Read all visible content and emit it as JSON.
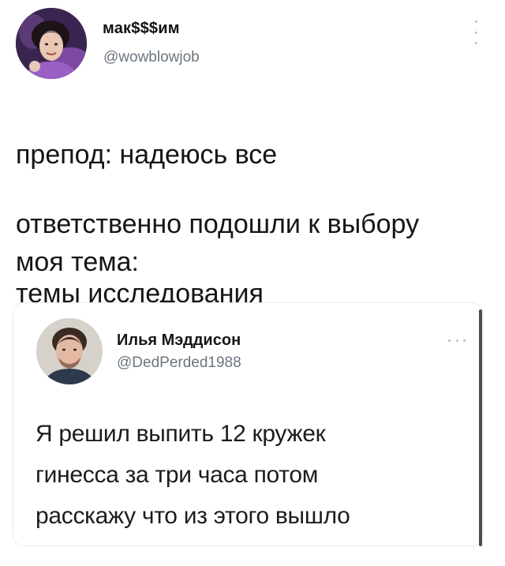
{
  "author": {
    "name": "мак$$$им",
    "handle": "@wowblowjob",
    "avatar_icon": "profile-photo-icon"
  },
  "tweet": {
    "lines": [
      "препод: надеюсь все",
      "ответственно подошли к выбору",
      "темы исследования"
    ],
    "followup": "моя тема:"
  },
  "quoted": {
    "name": "Илья Мэддисон",
    "handle": "@DedPerded1988",
    "avatar_icon": "profile-photo-icon",
    "lines": [
      "Я решил выпить 12 кружек",
      "гинесса за три часа  потом",
      "расскажу что из этого вышло"
    ]
  },
  "colors": {
    "text": "#131517",
    "secondary_text": "#6b7580",
    "border": "#e6ecf0"
  }
}
